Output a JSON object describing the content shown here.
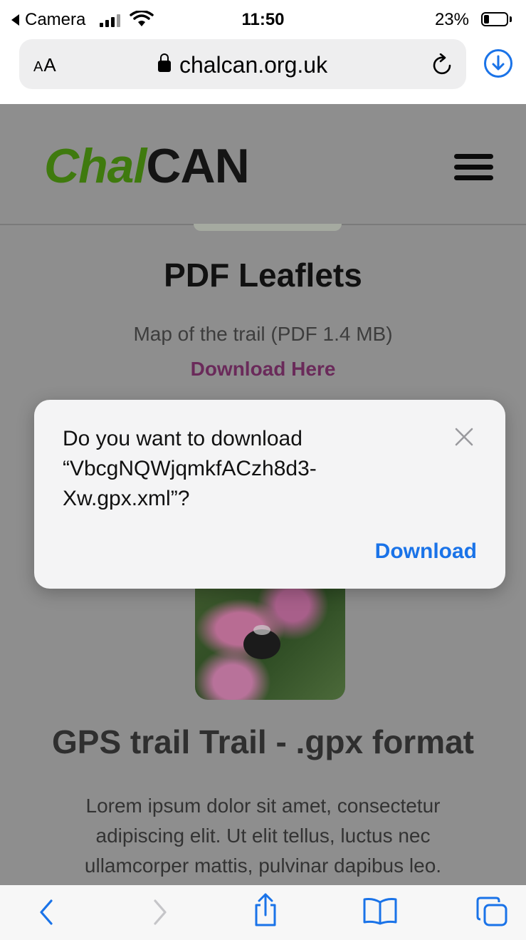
{
  "status_bar": {
    "back_app": "Camera",
    "time": "11:50",
    "battery_percent": "23%",
    "battery_level": 0.23
  },
  "address_bar": {
    "aa_label_small": "A",
    "aa_label_large": "A",
    "url": "chalcan.org.uk",
    "icons": [
      "lock-icon",
      "reload-icon",
      "download-circle-icon"
    ]
  },
  "site": {
    "logo_part1": "Chal",
    "logo_part2": "CAN",
    "menu_icon": "hamburger-icon",
    "leaflets_heading": "PDF Leaflets",
    "leaflet_desc": "Map of the trail (PDF 1.4 MB)",
    "leaflet_link": "Download Here",
    "gps_heading": "GPS trail Trail - .gpx format",
    "gps_body": "Lorem ipsum dolor sit amet, consectetur adipiscing elit. Ut elit tellus, luctus nec ullamcorper mattis, pulvinar dapibus leo."
  },
  "dialog": {
    "message": "Do you want to download “VbcgNQWjqmkfACzh8d3-Xw.gpx.xml”?",
    "action": "Download"
  },
  "toolbar": {
    "icons": [
      "back-icon",
      "forward-icon",
      "share-icon",
      "bookmarks-icon",
      "tabs-icon"
    ],
    "accent_color": "#1a73e8"
  }
}
